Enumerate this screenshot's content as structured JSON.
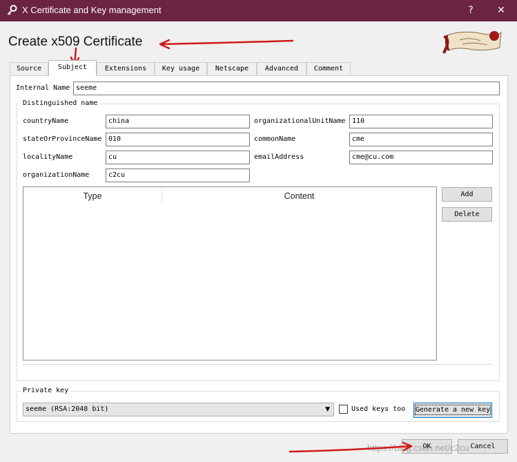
{
  "window": {
    "title": "X Certificate and Key management",
    "minimize_glyph": "?",
    "close_glyph": "✕"
  },
  "heading": "Create x509 Certificate",
  "tabs": [
    {
      "label": "Source",
      "active": false
    },
    {
      "label": "Subject",
      "active": true
    },
    {
      "label": "Extensions",
      "active": false
    },
    {
      "label": "Key usage",
      "active": false
    },
    {
      "label": "Netscape",
      "active": false
    },
    {
      "label": "Advanced",
      "active": false
    },
    {
      "label": "Comment",
      "active": false
    }
  ],
  "subject": {
    "internal_name_label": "Internal Name",
    "internal_name_value": "seeme",
    "dn_group_title": "Distinguished name",
    "fields": {
      "countryName": {
        "label": "countryName",
        "value": "china"
      },
      "stateOrProvinceName": {
        "label": "stateOrProvinceName",
        "value": "010"
      },
      "localityName": {
        "label": "localityName",
        "value": "cu"
      },
      "organizationName": {
        "label": "organizationName",
        "value": "c2cu"
      },
      "organizationalUnitName": {
        "label": "organizationalUnitName",
        "value": "110"
      },
      "commonName": {
        "label": "commonName",
        "value": "cme"
      },
      "emailAddress": {
        "label": "emailAddress",
        "value": "cme@cu.com"
      }
    },
    "table": {
      "columns": [
        "Type",
        "Content"
      ],
      "rows": []
    },
    "add_label": "Add",
    "delete_label": "Delete",
    "private_key": {
      "group_title": "Private key",
      "selected": "seeme (RSA:2048 bit)",
      "used_keys_label": "Used keys too",
      "used_keys_checked": false,
      "generate_label": "Generate a new key"
    }
  },
  "footer": {
    "ok_label": "OK",
    "cancel_label": "Cancel",
    "watermark": "https://blog.csdn.net/c2cu"
  },
  "colors": {
    "titlebar": "#6b2540",
    "annotation_arrow": "#d01818"
  }
}
